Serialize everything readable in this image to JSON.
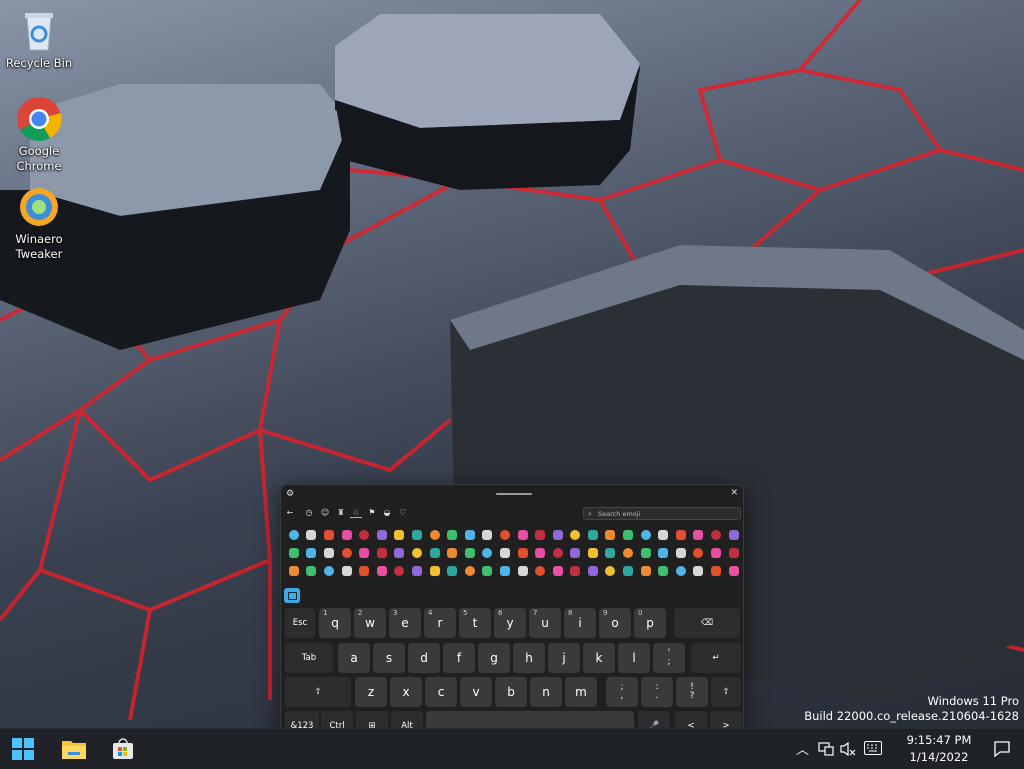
{
  "desktop": {
    "icons": [
      {
        "label": "Recycle Bin",
        "icon": "recycle-bin-icon"
      },
      {
        "label": "Google Chrome",
        "icon": "chrome-icon"
      },
      {
        "label": "Winaero Tweaker",
        "icon": "winaero-tweaker-icon"
      }
    ],
    "watermark": {
      "line1": "Windows 11 Pro",
      "line2": "Build 22000.co_release.210604-1628"
    }
  },
  "touch_keyboard": {
    "search_placeholder": "Search emoji",
    "categories": [
      "back-arrow-icon",
      "recent-icon",
      "smiley-icon",
      "people-icon",
      "clothing-icon",
      "flag-icon",
      "car-icon",
      "heart-icon"
    ],
    "keys": {
      "row1": [
        {
          "label": "Esc"
        },
        {
          "label": "q",
          "sup": "1"
        },
        {
          "label": "w",
          "sup": "2"
        },
        {
          "label": "e",
          "sup": "3"
        },
        {
          "label": "r",
          "sup": "4"
        },
        {
          "label": "t",
          "sup": "5"
        },
        {
          "label": "y",
          "sup": "6"
        },
        {
          "label": "u",
          "sup": "7"
        },
        {
          "label": "i",
          "sup": "8"
        },
        {
          "label": "o",
          "sup": "9"
        },
        {
          "label": "p",
          "sup": "0"
        },
        {
          "label": "⌫"
        }
      ],
      "row2": [
        {
          "label": "Tab"
        },
        {
          "label": "a"
        },
        {
          "label": "s"
        },
        {
          "label": "d"
        },
        {
          "label": "f"
        },
        {
          "label": "g"
        },
        {
          "label": "h"
        },
        {
          "label": "j"
        },
        {
          "label": "k"
        },
        {
          "label": "l"
        },
        {
          "top": "'",
          "bottom": ";"
        },
        {
          "label": "↵"
        }
      ],
      "row3": [
        {
          "label": "⇧"
        },
        {
          "label": "z"
        },
        {
          "label": "x"
        },
        {
          "label": "c"
        },
        {
          "label": "v"
        },
        {
          "label": "b"
        },
        {
          "label": "n"
        },
        {
          "label": "m"
        },
        {
          "top": ";",
          "bottom": ","
        },
        {
          "top": ":",
          "bottom": "."
        },
        {
          "top": "!",
          "bottom": "?"
        },
        {
          "label": "⇧"
        }
      ],
      "row4": [
        {
          "label": "&123"
        },
        {
          "label": "Ctrl"
        },
        {
          "label": "⊞"
        },
        {
          "label": "Alt"
        },
        {
          "label": ""
        },
        {
          "label": "🎤"
        },
        {
          "label": "<"
        },
        {
          "label": ">"
        }
      ]
    }
  },
  "taskbar": {
    "apps": [
      "start-icon",
      "file-explorer-icon",
      "microsoft-store-icon"
    ],
    "tray": {
      "time": "9:15:47 PM",
      "date": "1/14/2022"
    }
  }
}
